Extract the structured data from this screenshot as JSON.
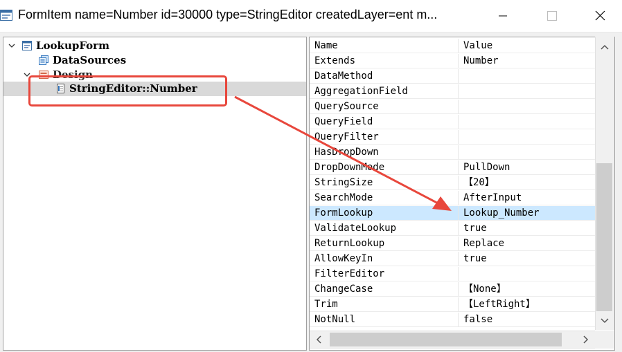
{
  "window": {
    "title": "FormItem name=Number id=30000 type=StringEditor createdLayer=ent m...",
    "icons": {
      "app": "form-window-icon",
      "minimize": "minimize-icon",
      "maximize": "maximize-icon",
      "close": "close-icon"
    }
  },
  "tree": {
    "items": [
      {
        "label": "LookupForm",
        "icon": "form-icon",
        "expanded": true
      },
      {
        "label": "DataSources",
        "icon": "datasources-icon"
      },
      {
        "label": "Design",
        "icon": "design-icon",
        "expanded": true
      },
      {
        "label": "StringEditor::Number",
        "icon": "string-editor-icon",
        "selected": true
      }
    ]
  },
  "properties": {
    "header": {
      "name": "Name",
      "value": "Value"
    },
    "rows": [
      {
        "name": "Extends",
        "value": "Number"
      },
      {
        "name": "DataMethod",
        "value": ""
      },
      {
        "name": "AggregationField",
        "value": ""
      },
      {
        "name": "QuerySource",
        "value": ""
      },
      {
        "name": "QueryField",
        "value": ""
      },
      {
        "name": "QueryFilter",
        "value": ""
      },
      {
        "name": "HasDropDown",
        "value": ""
      },
      {
        "name": "DropDownMode",
        "value": "PullDown"
      },
      {
        "name": "StringSize",
        "value": "【20】"
      },
      {
        "name": "SearchMode",
        "value": "AfterInput"
      },
      {
        "name": "FormLookup",
        "value": "Lookup_Number",
        "selected": true
      },
      {
        "name": "ValidateLookup",
        "value": "true"
      },
      {
        "name": "ReturnLookup",
        "value": "Replace"
      },
      {
        "name": "AllowKeyIn",
        "value": "true"
      },
      {
        "name": "FilterEditor",
        "value": ""
      },
      {
        "name": "ChangeCase",
        "value": "【None】"
      },
      {
        "name": "Trim",
        "value": "【LeftRight】"
      },
      {
        "name": "NotNull",
        "value": "false"
      }
    ]
  },
  "colors": {
    "annotation": "#e8473c",
    "selection": "#cce8ff",
    "tree_selection": "#d9d9d9"
  }
}
